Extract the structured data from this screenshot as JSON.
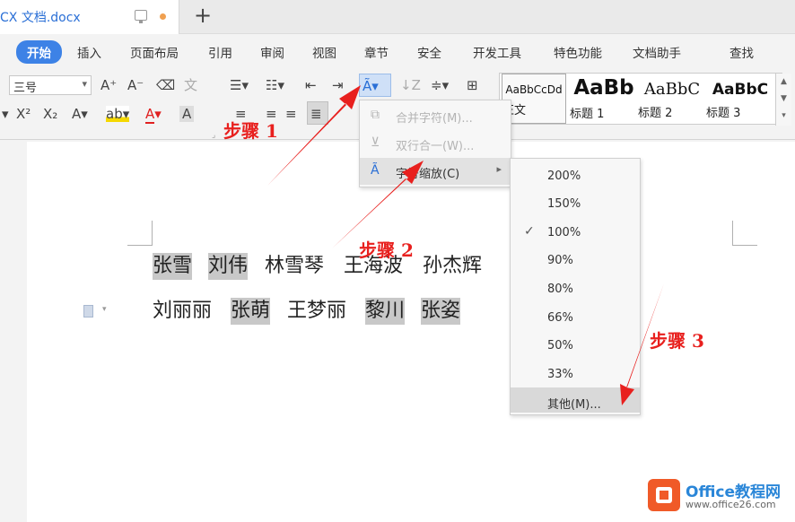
{
  "titlebar": {
    "doc_title": "CX 文档.docx",
    "new_tab": "+"
  },
  "menu_tabs": [
    "开始",
    "插入",
    "页面布局",
    "引用",
    "审阅",
    "视图",
    "章节",
    "安全",
    "开发工具",
    "特色功能",
    "文档助手"
  ],
  "search_label": "查找",
  "ribbon": {
    "font_size": "三号",
    "style_gallery": [
      {
        "preview": "AaBbCcDd",
        "name": "正文"
      },
      {
        "preview": "AaBb",
        "name": "标题 1"
      },
      {
        "preview": "AaBbC",
        "name": "标题 2"
      },
      {
        "preview": "AaBbC",
        "name": "标题 3"
      }
    ]
  },
  "document": {
    "line1": [
      "张雪",
      "刘伟",
      "林雪琴",
      "王海波",
      "孙杰辉"
    ],
    "line2": [
      "刘丽丽",
      "张萌",
      "王梦丽",
      "黎川",
      "张姿"
    ]
  },
  "menu1": {
    "items": [
      {
        "label": "合并字符(M)...",
        "icon": "merge-char-icon",
        "disabled": true
      },
      {
        "label": "双行合一(W)...",
        "icon": "two-lines-icon",
        "disabled": true
      },
      {
        "label": "字符缩放(C)",
        "icon": "char-scale-icon",
        "disabled": false,
        "submenu": true
      }
    ]
  },
  "scale_submenu": {
    "items": [
      "200%",
      "150%",
      "100%",
      "90%",
      "80%",
      "66%",
      "50%",
      "33%",
      "其他(M)..."
    ],
    "checked": "100%",
    "hovered": "其他(M)..."
  },
  "annotations": {
    "step1": "步骤 1",
    "step2": "步骤 2",
    "step3": "步骤 3"
  },
  "watermark": {
    "brand": "Office教程网",
    "url": "www.office26.com"
  },
  "colors": {
    "accent": "#3d82e6",
    "annotation": "#e8201e",
    "highlight": "#c8c8c8"
  }
}
